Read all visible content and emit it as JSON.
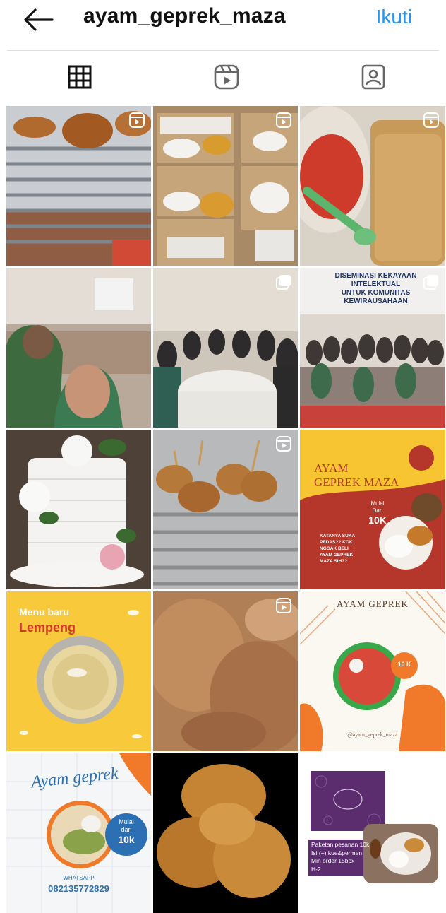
{
  "header": {
    "username": "ayam_geprek_maza",
    "follow_label": "Ikuti"
  },
  "tabs": [
    {
      "icon": "grid-icon",
      "active": true
    },
    {
      "icon": "reels-icon",
      "active": false
    },
    {
      "icon": "tagged-icon",
      "active": false
    }
  ],
  "posts": {
    "p5": {
      "banner_line1": "DISEMINASI KEKAYAAN INTELEKTUAL",
      "banner_line2": "UNTUK KOMUNITAS KEWIRAUSAHAAN"
    },
    "p9": {
      "title_line1": "AYAM",
      "title_line2": "GEPREK MAZA",
      "badge_line1": "Mulai",
      "badge_line2": "Dari",
      "badge_line3": "10K",
      "body_line1": "KATANYA SUKA",
      "body_line2": "PEDAS?? KOK",
      "body_line3": "NGGAK BELI",
      "body_line4": "AYAM GEPREK",
      "body_line5": "MAZA SIH??"
    },
    "p10": {
      "title_line1": "Menu baru",
      "title_line2": "Lempeng"
    },
    "p12": {
      "title": "AYAM GEPREK",
      "price": "10 K",
      "handle": "@ayam_geprek_maza"
    },
    "p13": {
      "title": "Ayam geprek",
      "price_line1": "Mulai",
      "price_line2": "dari",
      "price_line3": "10k",
      "wa_label": "WHATSAPP",
      "wa_number": "082135772829"
    },
    "p15": {
      "line1": "Paketan pesanan 10k",
      "line2": "Isi (+) kue&permen",
      "line3": "Min order 15box",
      "line4": "H-2"
    }
  },
  "colors": {
    "follow": "#2196f3",
    "maza_yellow": "#f7c531",
    "maza_red": "#b5362a",
    "lempeng_yellow": "#f8c93a",
    "geprek_orange": "#f07a2a"
  }
}
